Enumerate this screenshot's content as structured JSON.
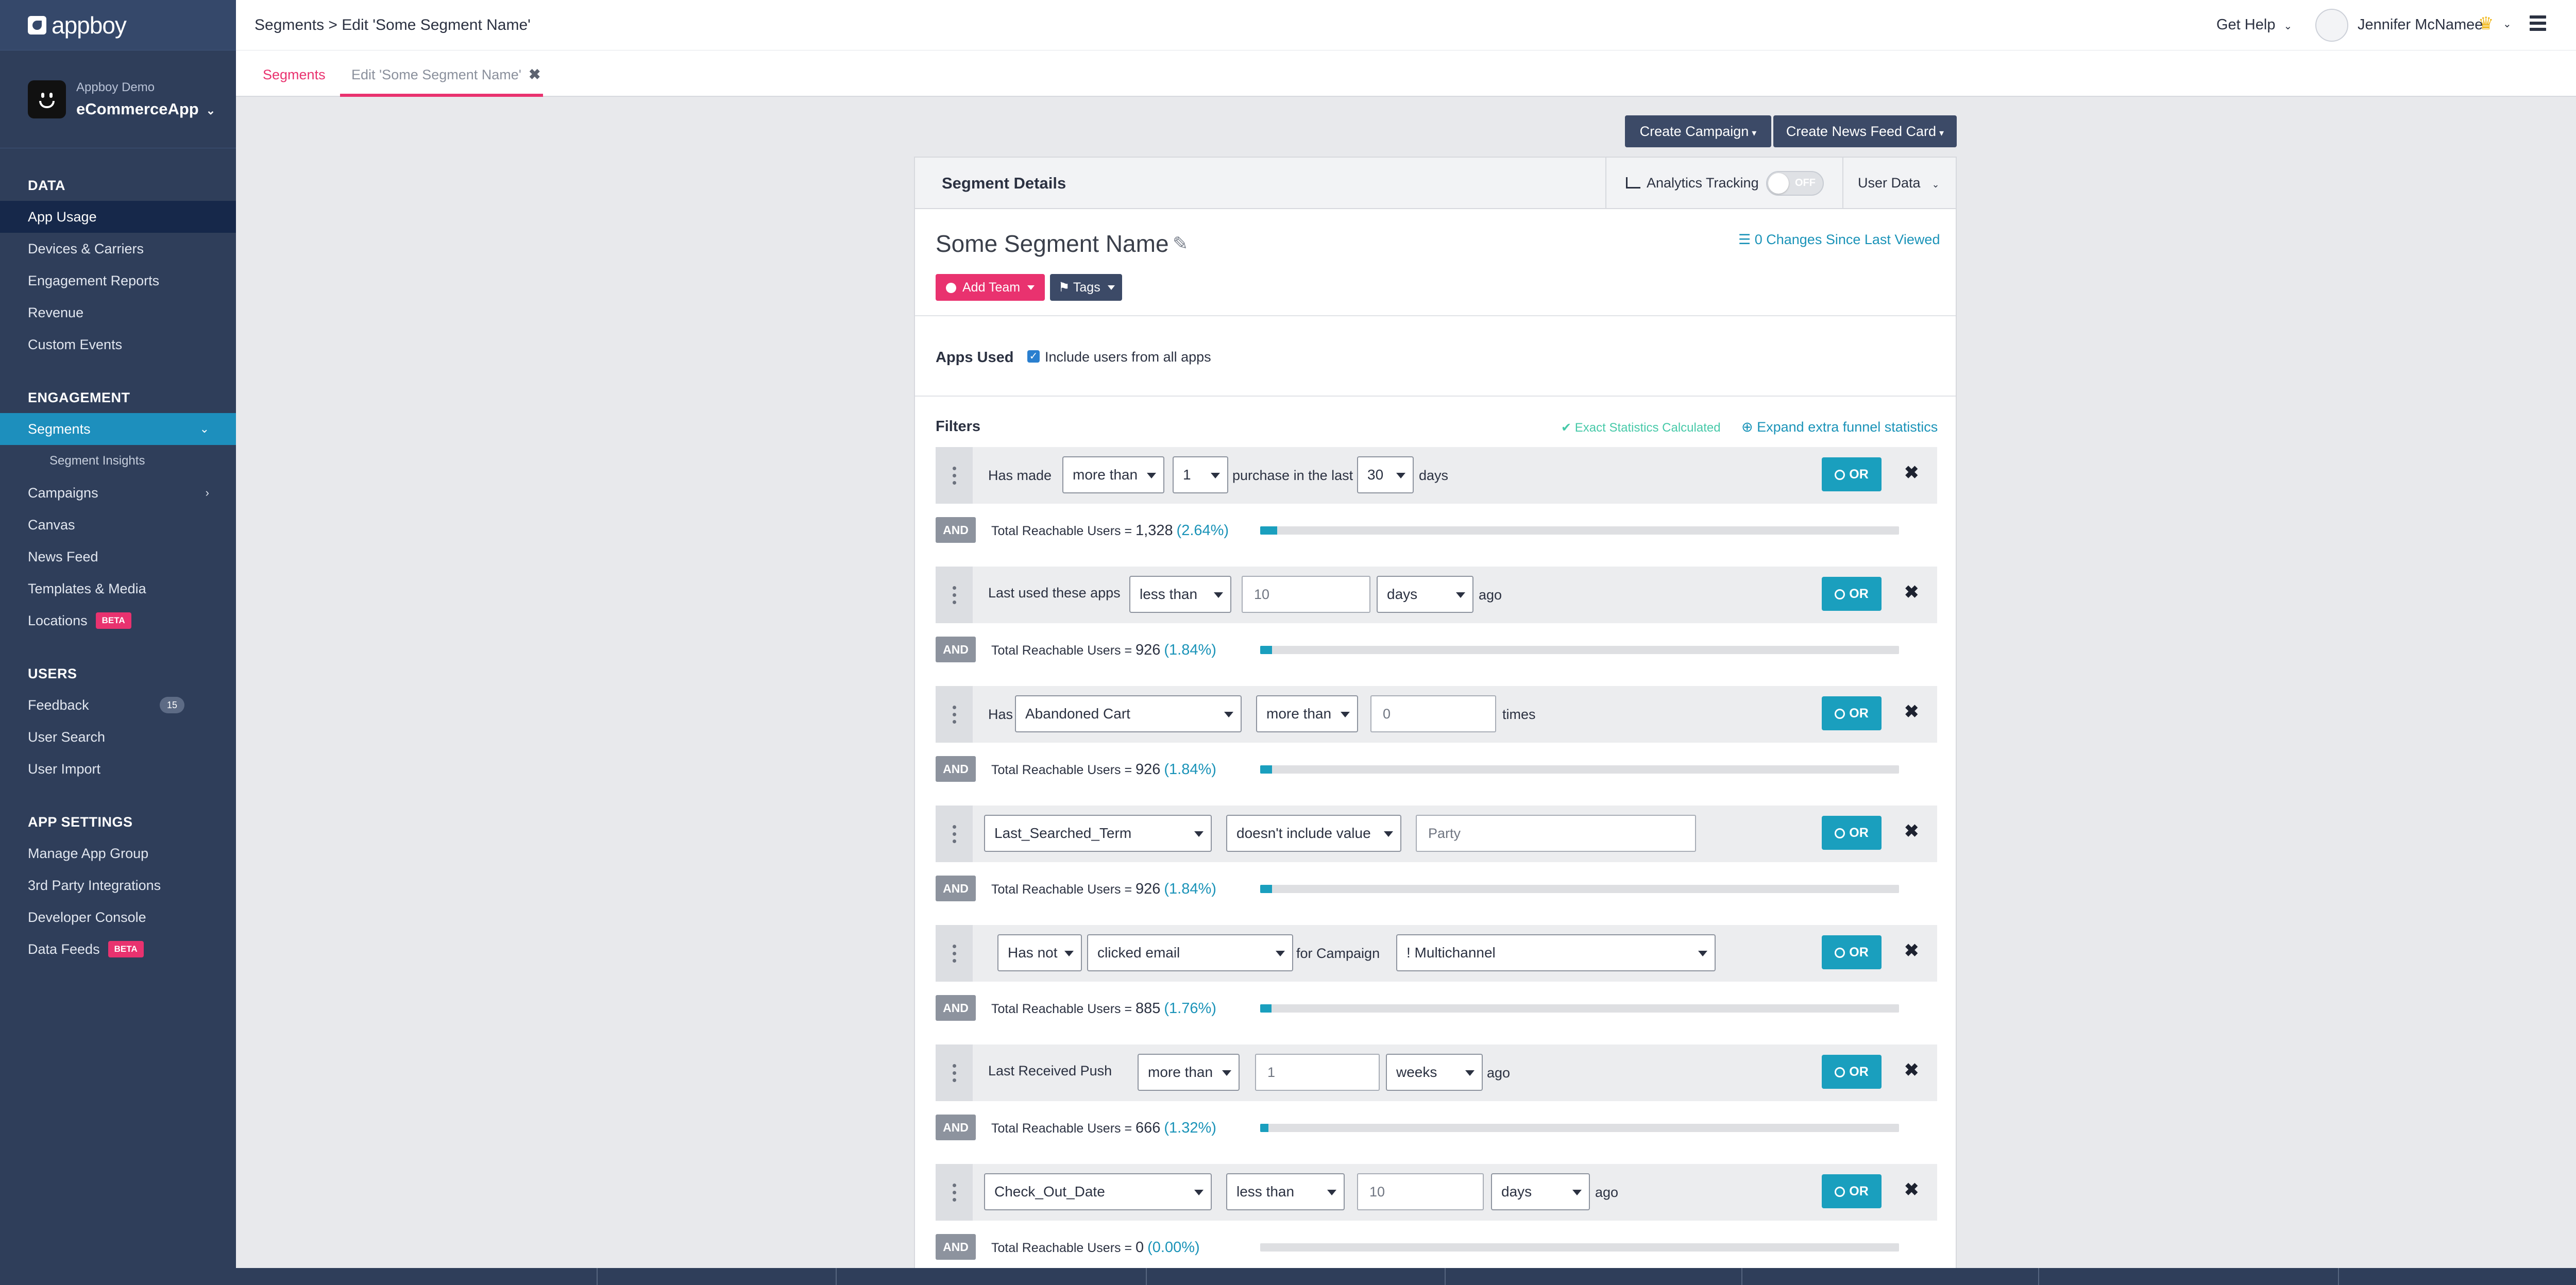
{
  "logo": {
    "text": "appboy"
  },
  "app": {
    "org": "Appboy Demo",
    "name": "eCommerceApp"
  },
  "sidebar": {
    "sections": [
      {
        "heading": "DATA",
        "items": [
          {
            "label": "App Usage",
            "state": "active"
          },
          {
            "label": "Devices & Carriers"
          },
          {
            "label": "Engagement Reports"
          },
          {
            "label": "Revenue"
          },
          {
            "label": "Custom Events"
          }
        ]
      },
      {
        "heading": "ENGAGEMENT",
        "items": [
          {
            "label": "Segments",
            "state": "selected"
          },
          {
            "label": "Segment Insights",
            "sub": true
          },
          {
            "label": "Campaigns"
          },
          {
            "label": "Canvas"
          },
          {
            "label": "News Feed"
          },
          {
            "label": "Templates & Media"
          },
          {
            "label": "Locations",
            "badge": "BETA"
          }
        ]
      },
      {
        "heading": "USERS",
        "items": [
          {
            "label": "Feedback",
            "count": "15"
          },
          {
            "label": "User Search"
          },
          {
            "label": "User Import"
          }
        ]
      },
      {
        "heading": "APP SETTINGS",
        "items": [
          {
            "label": "Manage App Group"
          },
          {
            "label": "3rd Party Integrations"
          },
          {
            "label": "Developer Console"
          },
          {
            "label": "Data Feeds",
            "badge": "BETA"
          }
        ]
      }
    ]
  },
  "topbar": {
    "breadcrumb": "Segments > Edit 'Some Segment Name'",
    "help": "Get Help",
    "user_name": "Jennifer McNamee"
  },
  "tabs": [
    {
      "label": "Segments"
    },
    {
      "label": "Edit 'Some Segment Name'"
    }
  ],
  "actions": {
    "create_campaign": "Create Campaign",
    "create_news_feed_card": "Create News Feed Card"
  },
  "panel": {
    "title": "Segment Details",
    "analytics_tracking": "Analytics Tracking",
    "toggle": "OFF",
    "user_data": "User Data",
    "segment_name": "Some Segment Name",
    "changes": "0 Changes Since Last Viewed",
    "add_team": "Add Team",
    "tags": "Tags",
    "apps_used": "Apps Used",
    "include_all_apps": "Include users from all apps",
    "filters_label": "Filters",
    "exact_stats": "Exact Statistics Calculated",
    "expand_funnel": "Expand extra funnel statistics",
    "or_label": "OR",
    "and_label": "AND",
    "reach_prefix": "Total Reachable Users = "
  },
  "filters": [
    {
      "has_made": "Has made",
      "comparator": "more than",
      "count": "1",
      "middle": "purchase in the last",
      "days": "30",
      "unit": "days"
    },
    {
      "label": "Last used these apps",
      "comparator": "less than",
      "value": "10",
      "unit": "days",
      "suffix": "ago"
    },
    {
      "prefix": "Has",
      "event": "Abandoned Cart",
      "comparator": "more than",
      "value": "0",
      "suffix": "times"
    },
    {
      "attribute": "Last_Searched_Term",
      "comparator": "doesn't include value",
      "value": "Party"
    },
    {
      "negation": "Has not",
      "action": "clicked email",
      "middle": "for Campaign",
      "campaign": "! Multichannel"
    },
    {
      "label": "Last Received Push",
      "comparator": "more than",
      "value": "1",
      "unit": "weeks",
      "suffix": "ago"
    },
    {
      "attribute": "Check_Out_Date",
      "comparator": "less than",
      "value": "10",
      "unit": "days",
      "suffix": "ago"
    }
  ],
  "reach": [
    {
      "count": "1,328",
      "pct": "(2.64%)",
      "fraction": 0.0264
    },
    {
      "count": "926",
      "pct": "(1.84%)",
      "fraction": 0.0184
    },
    {
      "count": "926",
      "pct": "(1.84%)",
      "fraction": 0.0184
    },
    {
      "count": "926",
      "pct": "(1.84%)",
      "fraction": 0.0184
    },
    {
      "count": "885",
      "pct": "(1.76%)",
      "fraction": 0.0176
    },
    {
      "count": "666",
      "pct": "(1.32%)",
      "fraction": 0.0132
    },
    {
      "count": "0",
      "pct": "(0.00%)",
      "fraction": 0
    }
  ],
  "colors": {
    "sidebar": "#2f3e5a",
    "accent_pink": "#e9326f",
    "accent_teal": "#1a9fbe",
    "dark_button": "#3c4a67"
  }
}
